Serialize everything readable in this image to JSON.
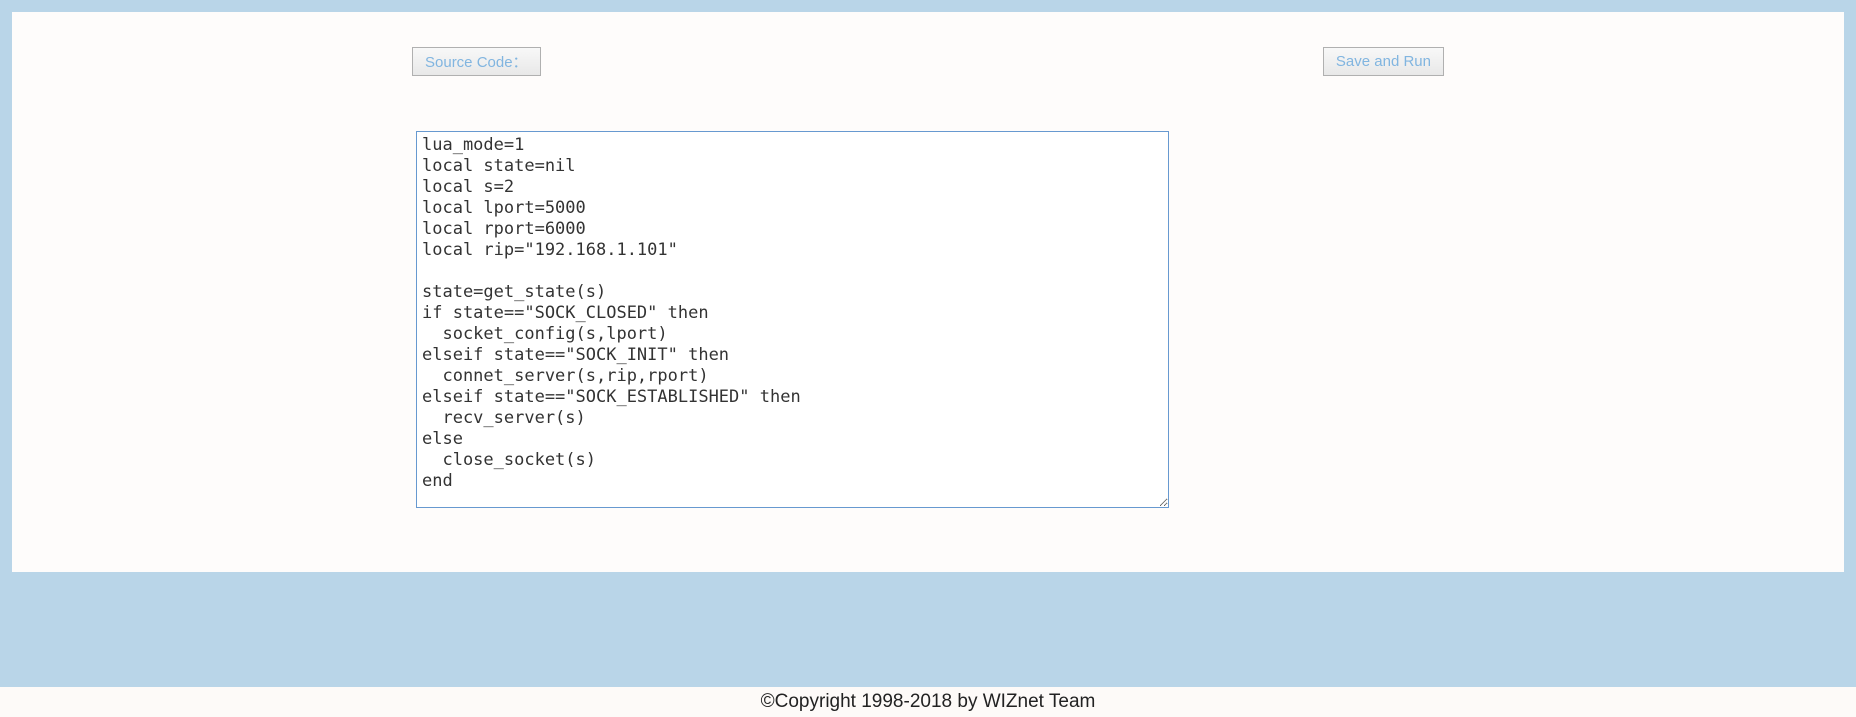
{
  "buttons": {
    "source_code_label": "Source Code：",
    "save_and_run_label": "Save and Run"
  },
  "code": "lua_mode=1\nlocal state=nil\nlocal s=2\nlocal lport=5000\nlocal rport=6000\nlocal rip=\"192.168.1.101\"\n\nstate=get_state(s)\nif state==\"SOCK_CLOSED\" then\n  socket_config(s,lport)\nelseif state==\"SOCK_INIT\" then\n  connet_server(s,rip,rport)\nelseif state==\"SOCK_ESTABLISHED\" then\n  recv_server(s)\nelse\n  close_socket(s)\nend",
  "footer": "©Copyright 1998-2018 by WIZnet Team"
}
